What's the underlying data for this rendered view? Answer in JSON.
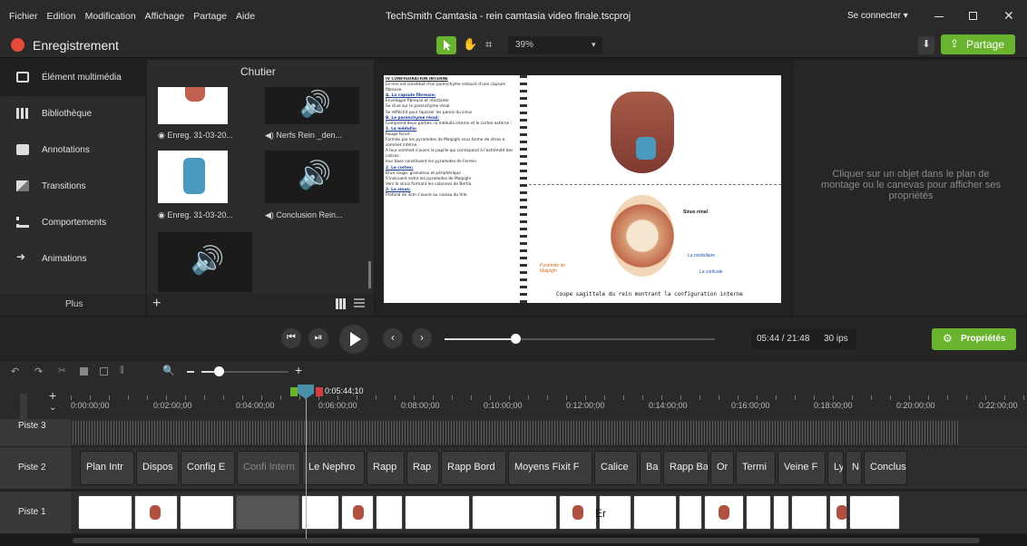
{
  "menu": [
    "Fichier",
    "Edition",
    "Modification",
    "Affichage",
    "Partage",
    "Aide"
  ],
  "window": {
    "title": "TechSmith Camtasia - rein camtasia video finale.tscproj",
    "login": "Se connecter ▾"
  },
  "toolbar": {
    "record": "Enregistrement",
    "zoom": "39%",
    "share": "Partage"
  },
  "left_tabs": [
    "Élément multimédia",
    "Bibliothèque",
    "Annotations",
    "Transitions",
    "Comportements",
    "Animations"
  ],
  "left_more": "Plus",
  "bin": {
    "title": "Chutier",
    "items": [
      "Enreg. 31-03-20...",
      "Nerfs Rein _den...",
      "Enreg. 31-03-20...",
      "Conclusion Rein..."
    ]
  },
  "slide": {
    "heading": "IV CONFIGURATION INTERNE",
    "lines": [
      "Le rein est constitué d'un parenchyme entouré d'une capsule fibreuse.",
      "A. La capsule fibreuse:",
      "Enveloppe fibreuse et résistante",
      "Se clive sur le parenchyme rénal.",
      "Se réfléchit pour tapisser les parois du sinus",
      "B. Le parenchyme rénal:",
      "Comprend deux parties: la médulla interne et le cortex externe :",
      "1. La médulla:",
      "Rouge foncé",
      "Formée par les pyramides de Malpighi sous forme de stries à sommet interne.",
      "A leur sommet s'ouvre la papille qui correspond à l'extrémité des calices.",
      "leur base constituent les pyramides de Ferrein.",
      "2. Le cortex:",
      "Brun rouge, granuleux et périphérique",
      "S'insinuent entre les pyramides de Malpighi",
      "Vers le sinus formant les colonnes de Bertin.",
      "3. Le sinus:",
      "Profond de 3cm s'ouvre au niveau du hile."
    ],
    "labels": [
      "Sinus rénal",
      "La médullaire",
      "La corticale",
      "Pyramide de Malpighi"
    ],
    "caption": "Coupe sagittale du rein montrant la configuration interne"
  },
  "properties": {
    "hint": "Cliquer sur un objet dans le plan de montage ou le canevas pour afficher ses propriétés",
    "button": "Propriétés"
  },
  "transport": {
    "time": "05:44 / 21:48",
    "fps": "30 ips"
  },
  "timeline": {
    "playhead": "0:05:44;10",
    "ticks": [
      "0:00:00;00",
      "0:02:00;00",
      "0:04:00;00",
      "0:06:00;00",
      "0:08:00;00",
      "0:10:00;00",
      "0:12:00;00",
      "0:14:00;00",
      "0:16:00;00",
      "0:18:00;00",
      "0:20:00;00",
      "0:22:00;00"
    ],
    "tracks": [
      "Piste 3",
      "Piste 2",
      "Piste 1"
    ],
    "clips2": [
      "Plan Intr",
      "Dispos",
      "Config E",
      "Confi Intern",
      "Le Nephro",
      "Rapp",
      "Rap",
      "Rapp Bord",
      "Moyens Fixit F",
      "Calice",
      "Ba",
      "Rapp Ba",
      "Or",
      "Termi",
      "Veine F",
      "Ly",
      "N",
      "Conclusi"
    ],
    "clip1_text": "Er"
  },
  "colors": {
    "accent": "#69b32f",
    "record": "#e54a3a",
    "bg": "#1f1f1f"
  }
}
